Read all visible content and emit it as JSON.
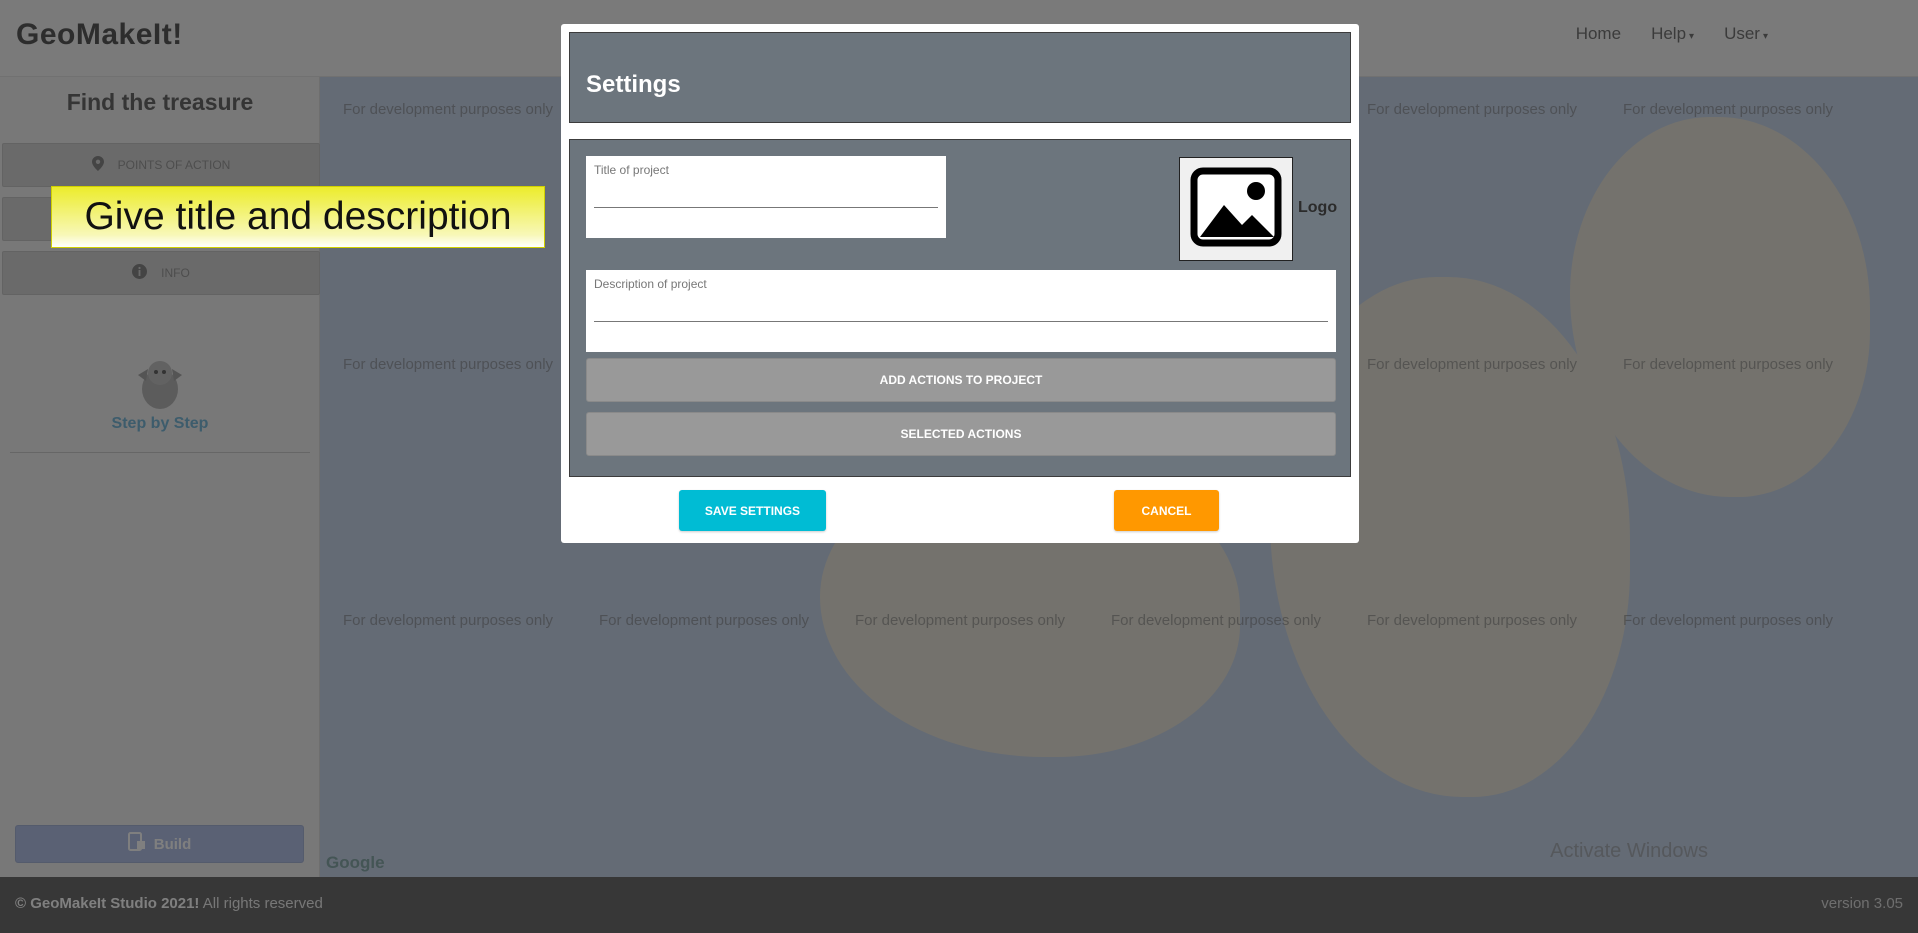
{
  "navbar": {
    "brand": "GeoMakeIt!",
    "links": [
      {
        "label": "Home"
      },
      {
        "label": "Help",
        "caret": "▾"
      },
      {
        "label": "User",
        "caret": "▾"
      }
    ]
  },
  "sidebar": {
    "title": "Find the treasure",
    "buttons": [
      {
        "label": "POINTS OF ACTION",
        "icon": "map-marker-icon"
      },
      {
        "label": "",
        "icon": ""
      },
      {
        "label": "INFO",
        "icon": "info-icon"
      }
    ],
    "step_label": "Step by Step",
    "build_label": "Build"
  },
  "map": {
    "watermark": "For development purposes only",
    "google": "Google",
    "activate_windows": "Activate Windows"
  },
  "hint": {
    "text": "Give title and description"
  },
  "modal": {
    "title": "Settings",
    "title_field": {
      "label": "Title of project",
      "value": ""
    },
    "description_field": {
      "label": "Description of project",
      "value": ""
    },
    "logo_label": "Logo",
    "add_actions_label": "ADD ACTIONS TO PROJECT",
    "selected_actions_label": "SELECTED ACTIONS",
    "save_label": "SAVE SETTINGS",
    "cancel_label": "CANCEL"
  },
  "footer": {
    "copyright_bold": "© GeoMakeIt Studio 2021!",
    "copyright_rest": " All rights reserved",
    "version": "version 3.05"
  },
  "colors": {
    "modal_panel": "#6c757d",
    "save_button": "#00bcd4",
    "cancel_button": "#ff9800",
    "gray_button": "#999999",
    "hint_yellow": "#ecec2c"
  }
}
